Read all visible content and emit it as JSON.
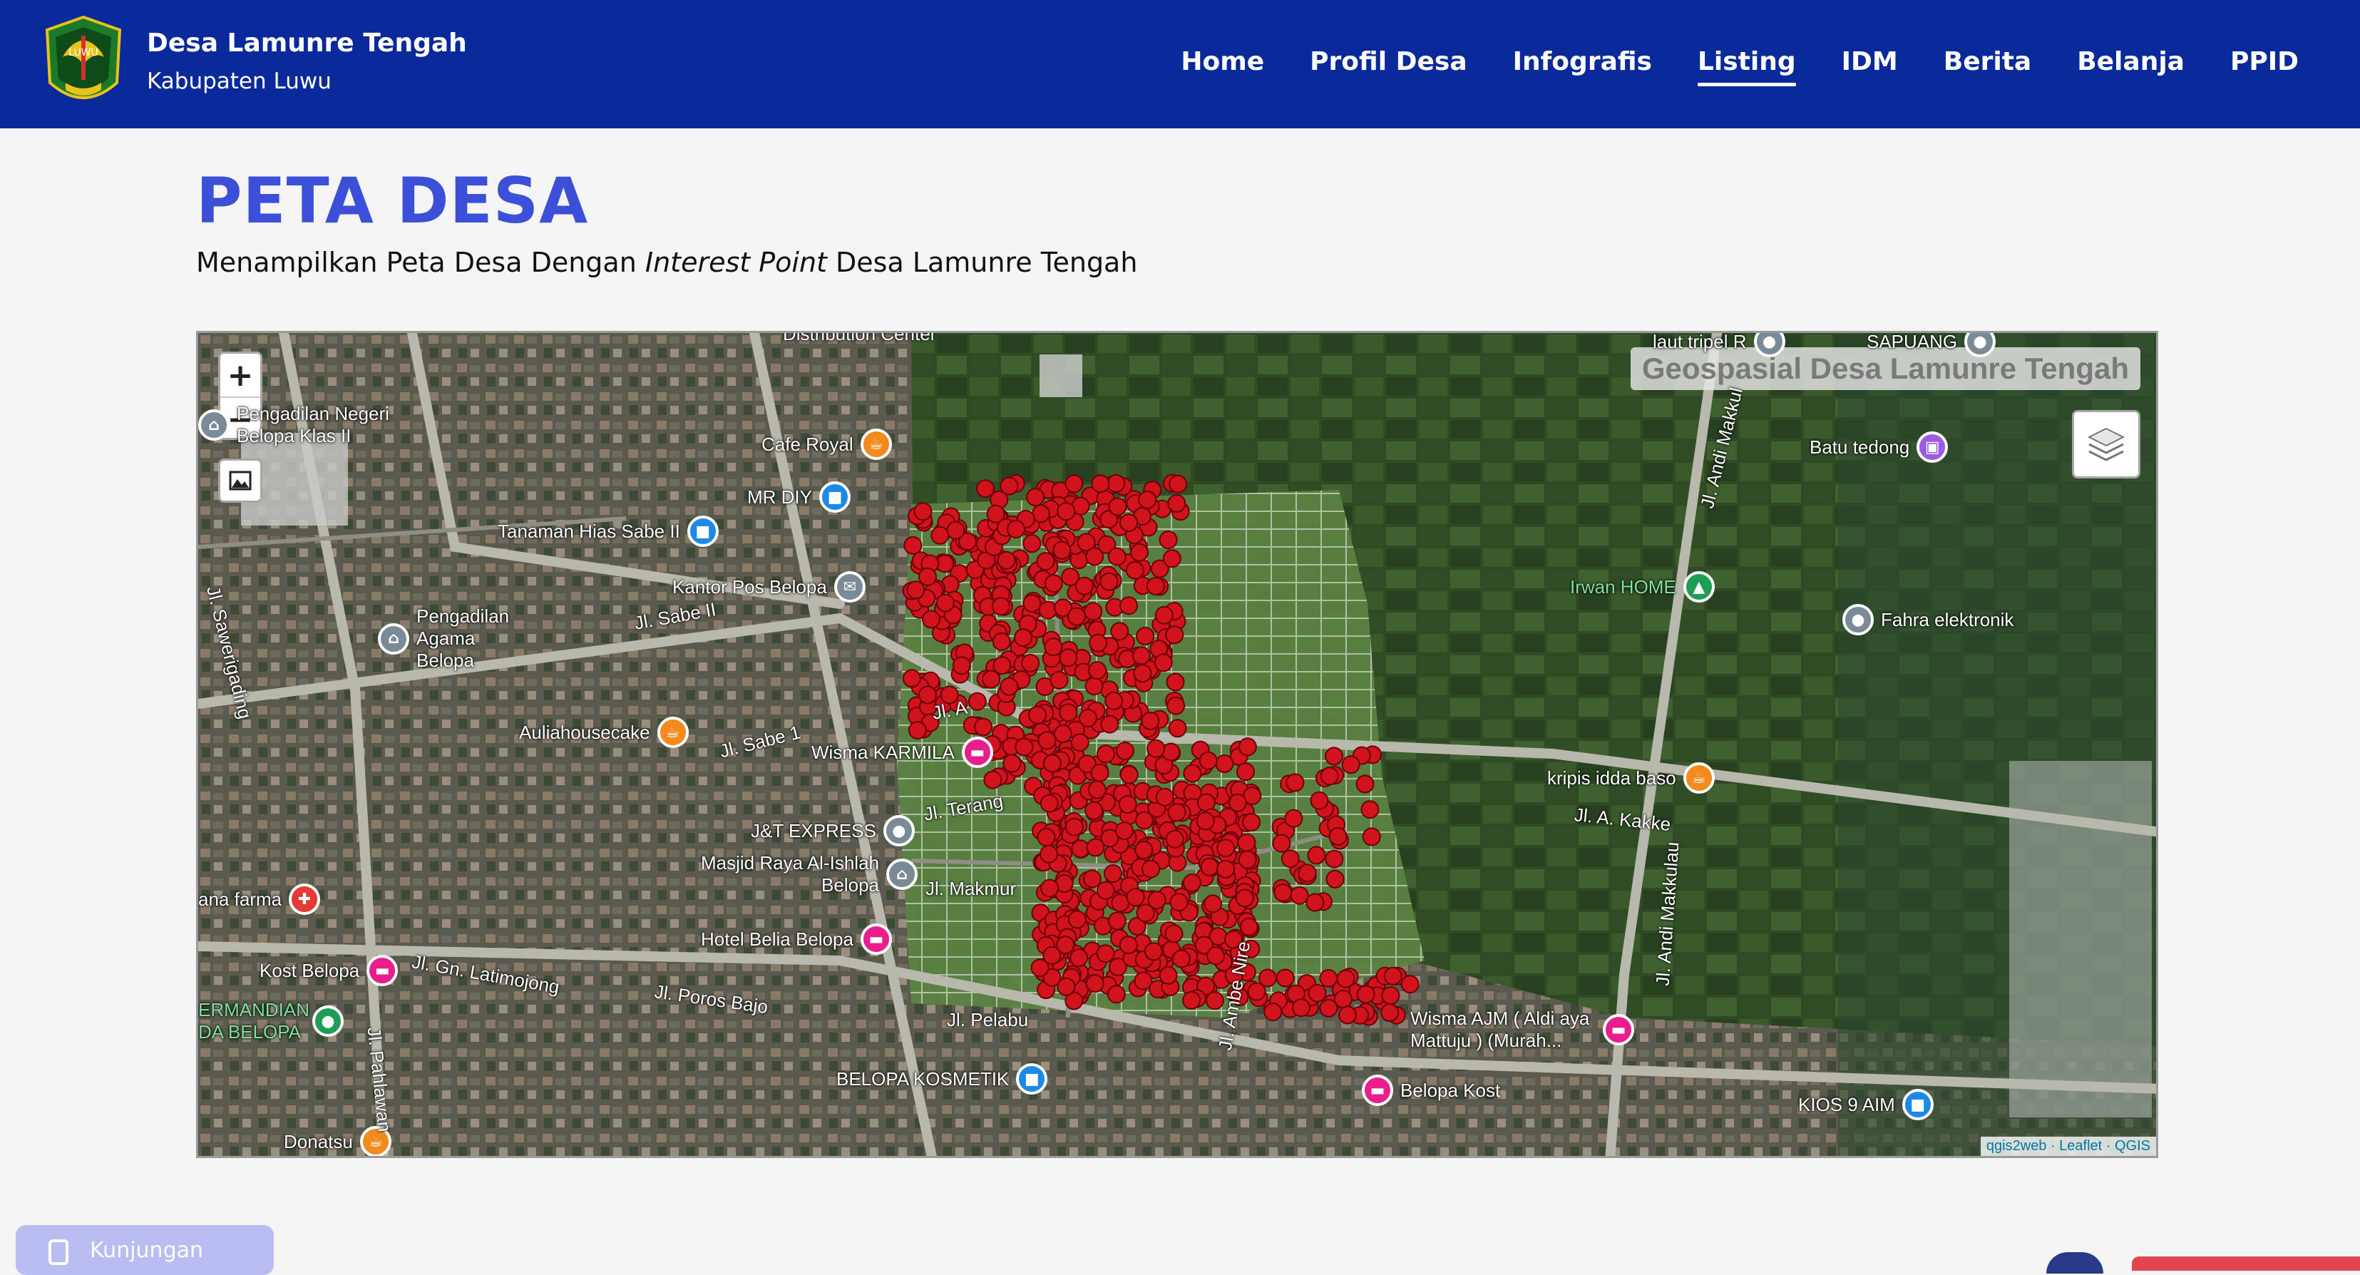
{
  "header": {
    "title": "Desa Lamunre Tengah",
    "subtitle": "Kabupaten Luwu",
    "nav": [
      {
        "label": "Home",
        "active": false
      },
      {
        "label": "Profil Desa",
        "active": false
      },
      {
        "label": "Infografis",
        "active": false
      },
      {
        "label": "Listing",
        "active": true
      },
      {
        "label": "IDM",
        "active": false
      },
      {
        "label": "Berita",
        "active": false
      },
      {
        "label": "Belanja",
        "active": false
      },
      {
        "label": "PPID",
        "active": false
      }
    ]
  },
  "page": {
    "title": "PETA DESA",
    "subtitle_pre": "Menampilkan Peta Desa Dengan ",
    "subtitle_em": "Interest Point",
    "subtitle_post": " Desa Lamunre Tengah"
  },
  "map": {
    "title": "Geospasial Desa Lamunre Tengah",
    "zoom_in": "+",
    "zoom_out": "−",
    "attribution": "qgis2web · Leaflet · QGIS",
    "pois": [
      {
        "label": "Cafe Royal",
        "color": "#f28a1e",
        "glyph": "☕"
      },
      {
        "label": "MR DIY",
        "color": "#1e88e5",
        "glyph": "■"
      },
      {
        "label": "Tanaman Hias Sabe II",
        "color": "#1e88e5",
        "glyph": "■"
      },
      {
        "label": "Kantor Pos Belopa",
        "color": "#7a8a96",
        "glyph": "✉"
      },
      {
        "label": "Pengadilan Agama Belopa",
        "color": "#7a8a96",
        "glyph": "⌂"
      },
      {
        "label": "Auliahousecake",
        "color": "#f28a1e",
        "glyph": "☕"
      },
      {
        "label": "Wisma KARMILA",
        "color": "#e91e8c",
        "glyph": "▬"
      },
      {
        "label": "J&T EXPRESS",
        "color": "#7a8a96",
        "glyph": "●"
      },
      {
        "label": "Masjid Raya Al-Ishlah Belopa",
        "color": "#7a8a96",
        "glyph": "⌂"
      },
      {
        "label": "Hotel Belia Belopa",
        "color": "#e91e8c",
        "glyph": "▬"
      },
      {
        "label": "Kost Belopa",
        "color": "#e91e8c",
        "glyph": "▬"
      },
      {
        "label": "ana farma",
        "color": "#e53935",
        "glyph": "✚"
      },
      {
        "label": "ERMANDIAN DA BELOPA",
        "color": "#1f9d55",
        "glyph": "●"
      },
      {
        "label": "Donatsu",
        "color": "#f28a1e",
        "glyph": "☕"
      },
      {
        "label": "BELOPA KOSMETIK",
        "color": "#1e88e5",
        "glyph": "■"
      },
      {
        "label": "Belopa Kost",
        "color": "#e91e8c",
        "glyph": "▬"
      },
      {
        "label": "Wisma AJM ( Aldi aya Mattuju ) (Murah...",
        "color": "#e91e8c",
        "glyph": "▬"
      },
      {
        "label": "KIOS 9 AIM",
        "color": "#1e88e5",
        "glyph": "■"
      },
      {
        "label": "kripis idda baso",
        "color": "#f28a1e",
        "glyph": "☕"
      },
      {
        "label": "Fahra elektronik",
        "color": "#7a8a96",
        "glyph": "●"
      },
      {
        "label": "Irwan HOME",
        "color": "#1f9d55",
        "glyph": "▲"
      },
      {
        "label": "Batu tedong",
        "color": "#9c5ce0",
        "glyph": "▣"
      },
      {
        "label": "laut tripel R",
        "color": "#7a8a96",
        "glyph": "●"
      },
      {
        "label": "SAPUANG",
        "color": "#7a8a96",
        "glyph": "●"
      },
      {
        "label": "Pengadilan Negeri Belopa Klas II",
        "color": "#7a8a96",
        "glyph": "⌂"
      },
      {
        "label": "Distribution Center",
        "color": "#7a8a96",
        "glyph": "●"
      }
    ],
    "roads": [
      "Jl. Sabe II",
      "Jl. Sabe 1",
      "Jl. Terang",
      "Jl. Makmur",
      "Jl. Pelabu",
      "Jl. Poros Bajo",
      "Jl. Gn. Latimojong",
      "Jl. Sawerigading",
      "Jl. Pahlawan",
      "Jl. Ambe Nire",
      "Jl. Andi Makkulau",
      "Jl. A. Kakke",
      "Jl. Andi Makkul",
      "Jl. A"
    ]
  },
  "footer": {
    "visit_label": "Kunjungan"
  }
}
